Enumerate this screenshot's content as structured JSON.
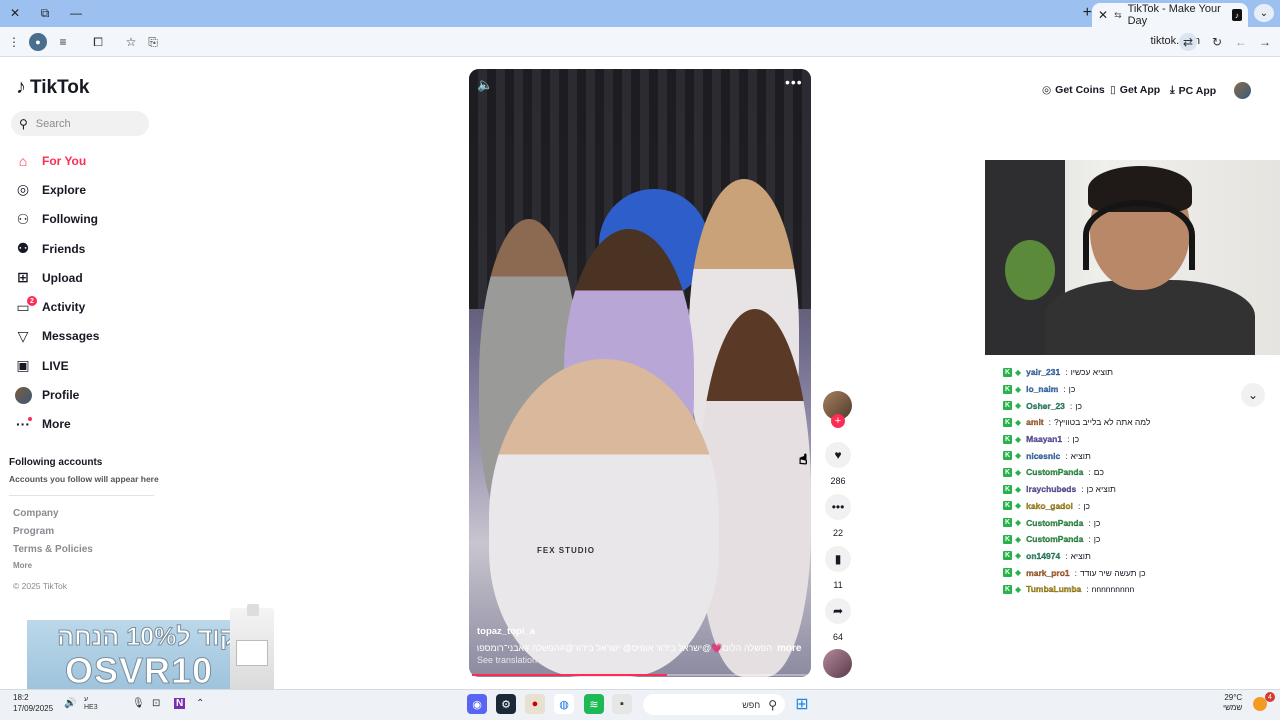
{
  "browser": {
    "tab_title": "TikTok - Make Your Day",
    "url": "tiktok.com",
    "icons": [
      "close-icon",
      "restore-icon",
      "minimize-icon",
      "new-tab-icon",
      "tab-close-icon",
      "tab-list-icon",
      "menu-icon",
      "profile-icon",
      "reading-icon",
      "extensions-icon",
      "bookmark-star-icon",
      "tab-search-icon",
      "translate-icon",
      "reload-icon",
      "back-icon",
      "forward-icon"
    ]
  },
  "sidebar": {
    "logo": "TikTok",
    "search_placeholder": "Search",
    "nav": [
      {
        "label": "For You",
        "icon": "home-icon",
        "active": true
      },
      {
        "label": "Explore",
        "icon": "compass-icon"
      },
      {
        "label": "Following",
        "icon": "following-icon"
      },
      {
        "label": "Friends",
        "icon": "friends-icon"
      },
      {
        "label": "Upload",
        "icon": "upload-icon"
      },
      {
        "label": "Activity",
        "icon": "activity-icon",
        "badge": "2"
      },
      {
        "label": "Messages",
        "icon": "messages-icon"
      },
      {
        "label": "LIVE",
        "icon": "live-icon"
      },
      {
        "label": "Profile",
        "icon": "avatar"
      },
      {
        "label": "More",
        "icon": "more-icon"
      }
    ],
    "following_title": "Following accounts",
    "following_sub": "Accounts you follow will appear here",
    "footer": [
      "Company",
      "Program",
      "Terms & Policies"
    ],
    "footer_more": "More",
    "copyright": "© 2025 TikTok"
  },
  "promo": {
    "line1": "קוד ל10% הנחה",
    "line2": "OSVR10"
  },
  "video": {
    "author": "topaz_topi_a",
    "caption": "הפשלה הלום💗@ישראל בידור אופיס@ ישראל בידור@#הפשלה #אבני־רומספריים ...",
    "more": "more",
    "translate": "See translation",
    "shirt": "FEX STUDIO",
    "progress": 0.58
  },
  "actions": {
    "likes": "286",
    "comments": "22",
    "saves": "11",
    "shares": "64"
  },
  "header": {
    "get_coins": "Get Coins",
    "get_app": "Get App",
    "pc_app": "PC App"
  },
  "chat": [
    {
      "name": "yair_231",
      "msg": "תוציא עכשיו",
      "color": "#2f7de1"
    },
    {
      "name": "lo_naim",
      "msg": "כן",
      "color": "#2f7de1"
    },
    {
      "name": "Osher_23",
      "msg": "כן",
      "color": "#1fa37a"
    },
    {
      "name": "amit",
      "msg": "למה אתה לא בלייב בטוויץ?",
      "color": "#d2691e"
    },
    {
      "name": "Maayan1",
      "msg": "כן",
      "color": "#6a5acd"
    },
    {
      "name": "nicesnic",
      "msg": "תוציא",
      "color": "#2f7de1"
    },
    {
      "name": "CustomPanda",
      "msg": "כם",
      "color": "#27b34a"
    },
    {
      "name": "lraychubeds",
      "msg": "תוציא כן",
      "color": "#6a5acd"
    },
    {
      "name": "kako_gadol",
      "msg": "כן",
      "color": "#c8a000"
    },
    {
      "name": "CustomPanda",
      "msg": "כן",
      "color": "#27b34a"
    },
    {
      "name": "CustomPanda",
      "msg": "כן",
      "color": "#27b34a"
    },
    {
      "name": "on14974",
      "msg": "תוציא",
      "color": "#1fa37a"
    },
    {
      "name": "mark_pro1",
      "msg": "כן תעשה שיר עודד",
      "color": "#d2691e"
    },
    {
      "name": "TumbaLumba",
      "msg": "nnnnnnnnn",
      "color": "#c8a000"
    }
  ],
  "taskbar": {
    "time": "18:2",
    "date": "17/09/2025",
    "lang": "HE3",
    "search": "חפש",
    "temp": "29°C",
    "weather_label": "שמשי",
    "notif_count": "4"
  }
}
